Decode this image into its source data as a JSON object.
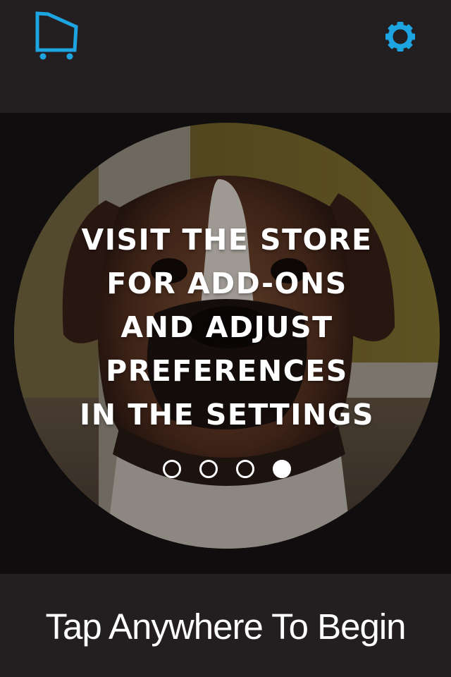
{
  "colors": {
    "accent": "#1da5e2",
    "bar_background": "#231f20",
    "hero_background": "#0f0d0e",
    "text": "#ffffff"
  },
  "header": {
    "left_icon": "shopping-cart-icon",
    "right_icon": "gear-icon"
  },
  "hero": {
    "image_subject": "boxer dog photo",
    "message_lines": [
      "VISIT THE STORE",
      "FOR ADD-ONS",
      "AND ADJUST",
      "PREFERENCES",
      "IN THE SETTINGS"
    ],
    "pager": {
      "total": 4,
      "active": 4
    }
  },
  "footer": {
    "cta": "Tap Anywhere To Begin"
  }
}
